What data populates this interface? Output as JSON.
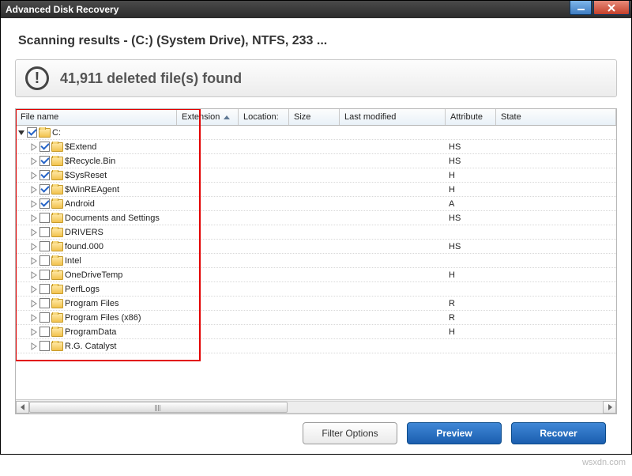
{
  "window": {
    "title": "Advanced Disk Recovery"
  },
  "heading": "Scanning results - (C:)  (System Drive), NTFS, 233 ...",
  "banner": {
    "icon_glyph": "!",
    "text": "41,911 deleted file(s) found"
  },
  "columns": {
    "name": "File name",
    "ext": "Extension",
    "loc": "Location:",
    "size": "Size",
    "mod": "Last modified",
    "attr": "Attribute",
    "state": "State"
  },
  "rows": [
    {
      "name": "C:",
      "indent": 0,
      "checked": true,
      "expanded": true,
      "attr": ""
    },
    {
      "name": "$Extend",
      "indent": 1,
      "checked": true,
      "expanded": false,
      "attr": "HS"
    },
    {
      "name": "$Recycle.Bin",
      "indent": 1,
      "checked": true,
      "expanded": false,
      "attr": "HS"
    },
    {
      "name": "$SysReset",
      "indent": 1,
      "checked": true,
      "expanded": false,
      "attr": "H"
    },
    {
      "name": "$WinREAgent",
      "indent": 1,
      "checked": true,
      "expanded": false,
      "attr": "H"
    },
    {
      "name": "Android",
      "indent": 1,
      "checked": true,
      "expanded": false,
      "attr": "A"
    },
    {
      "name": "Documents and Settings",
      "indent": 1,
      "checked": false,
      "expanded": false,
      "attr": "HS"
    },
    {
      "name": "DRIVERS",
      "indent": 1,
      "checked": false,
      "expanded": false,
      "attr": ""
    },
    {
      "name": "found.000",
      "indent": 1,
      "checked": false,
      "expanded": false,
      "attr": "HS"
    },
    {
      "name": "Intel",
      "indent": 1,
      "checked": false,
      "expanded": false,
      "attr": ""
    },
    {
      "name": "OneDriveTemp",
      "indent": 1,
      "checked": false,
      "expanded": false,
      "attr": "H"
    },
    {
      "name": "PerfLogs",
      "indent": 1,
      "checked": false,
      "expanded": false,
      "attr": ""
    },
    {
      "name": "Program Files",
      "indent": 1,
      "checked": false,
      "expanded": false,
      "attr": "R"
    },
    {
      "name": "Program Files (x86)",
      "indent": 1,
      "checked": false,
      "expanded": false,
      "attr": "R"
    },
    {
      "name": "ProgramData",
      "indent": 1,
      "checked": false,
      "expanded": false,
      "attr": "H"
    },
    {
      "name": "R.G. Catalyst",
      "indent": 1,
      "checked": false,
      "expanded": false,
      "attr": ""
    }
  ],
  "buttons": {
    "filter": "Filter Options",
    "preview": "Preview",
    "recover": "Recover"
  },
  "watermark": "wsxdn.com"
}
